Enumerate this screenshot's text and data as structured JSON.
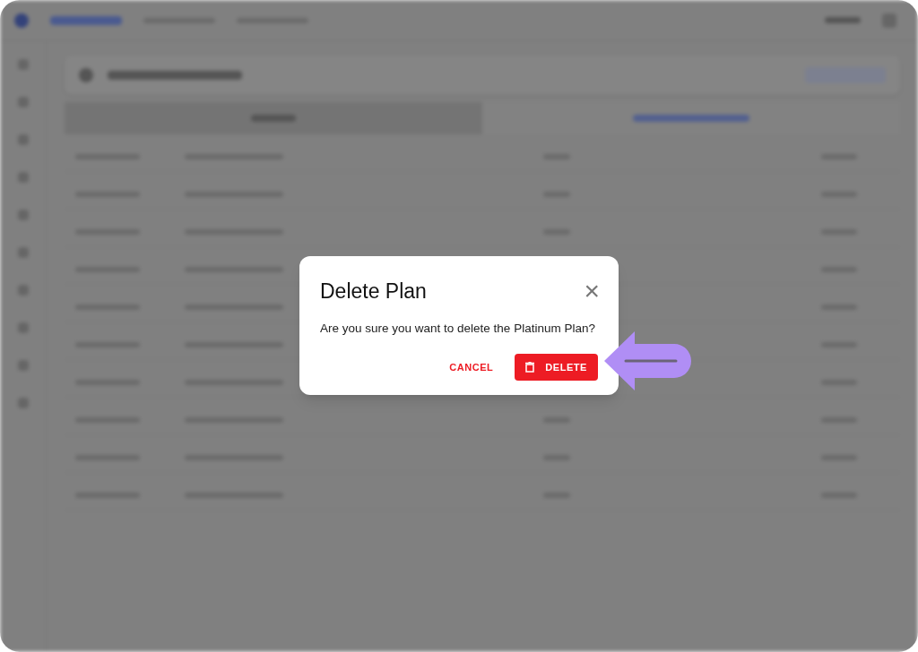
{
  "dialog": {
    "title": "Delete Plan",
    "message": "Are you sure you want to delete the Platinum Plan?",
    "close": "×",
    "buttons": [
      {
        "kind": "text",
        "label": "CANCEL"
      },
      {
        "kind": "danger",
        "label": "DELETE"
      }
    ]
  }
}
